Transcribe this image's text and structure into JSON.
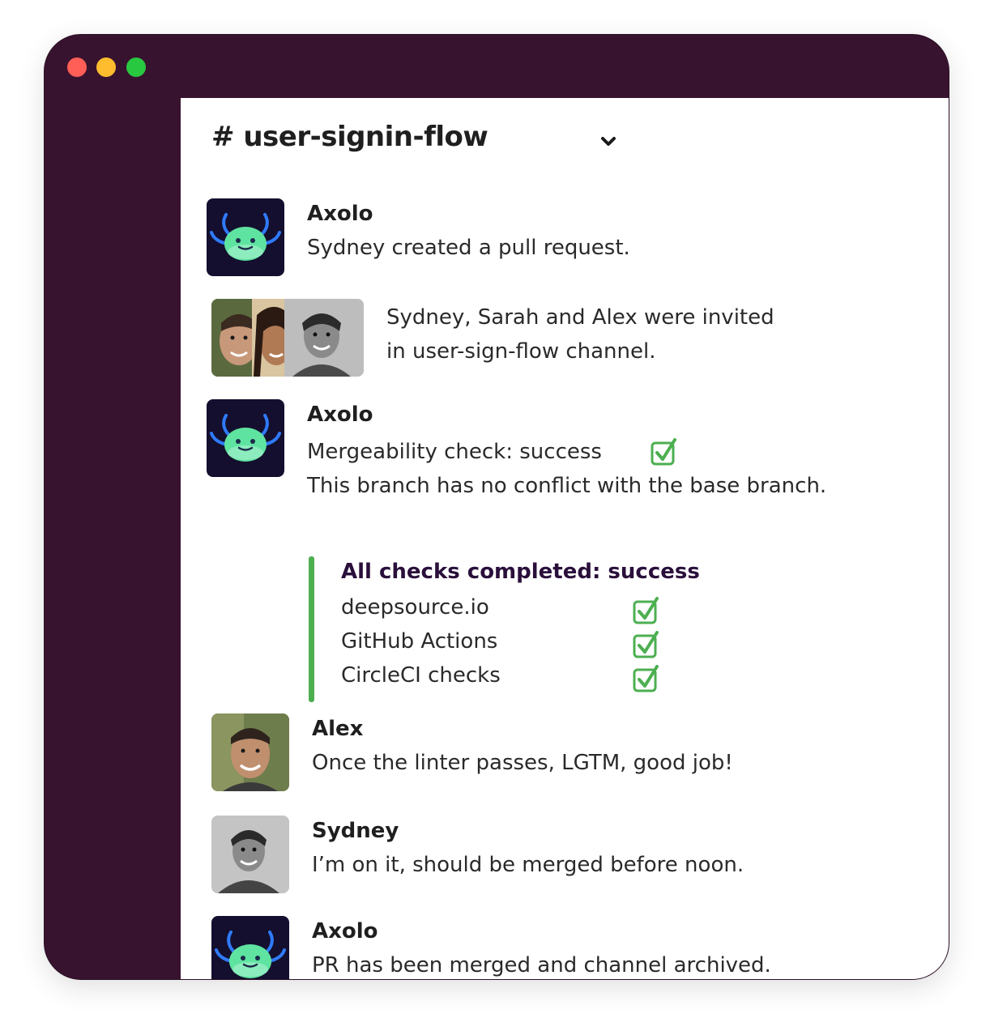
{
  "window": {
    "controls": [
      "close-dot",
      "minimize-dot",
      "zoom-dot"
    ],
    "colors": {
      "frame": "#38132f",
      "close": "#ff5f57",
      "minimize": "#febc2e",
      "zoom": "#28c840",
      "success": "#4caf50"
    }
  },
  "channel": {
    "title": "# user-signin-flow",
    "dropdown_icon": "chevron-down-icon"
  },
  "messages": [
    {
      "author": "Axolo",
      "avatar": "axolo-bot-icon",
      "lines": [
        "Sydney created a pull request."
      ]
    },
    {
      "author": "",
      "avatar": "group-avatars",
      "lines": [
        "Sydney, Sarah and Alex were invited",
        "in user-sign-flow channel."
      ]
    },
    {
      "author": "Axolo",
      "avatar": "axolo-bot-icon",
      "lines": [
        "Mergeability check: success",
        "This branch has no conflict with the base branch."
      ]
    },
    {
      "author": "Alex",
      "avatar": "alex-avatar",
      "lines": [
        "Once the linter passes, LGTM, good job!"
      ]
    },
    {
      "author": "Sydney",
      "avatar": "sydney-avatar",
      "lines": [
        "I’m on it, should be merged before noon."
      ]
    },
    {
      "author": "Axolo",
      "avatar": "axolo-bot-icon",
      "lines": [
        "PR has been merged and channel archived."
      ]
    }
  ],
  "checks": {
    "title": "All checks completed: success",
    "items": [
      "deepsource.io",
      "GitHub Actions",
      "CircleCI checks"
    ]
  }
}
